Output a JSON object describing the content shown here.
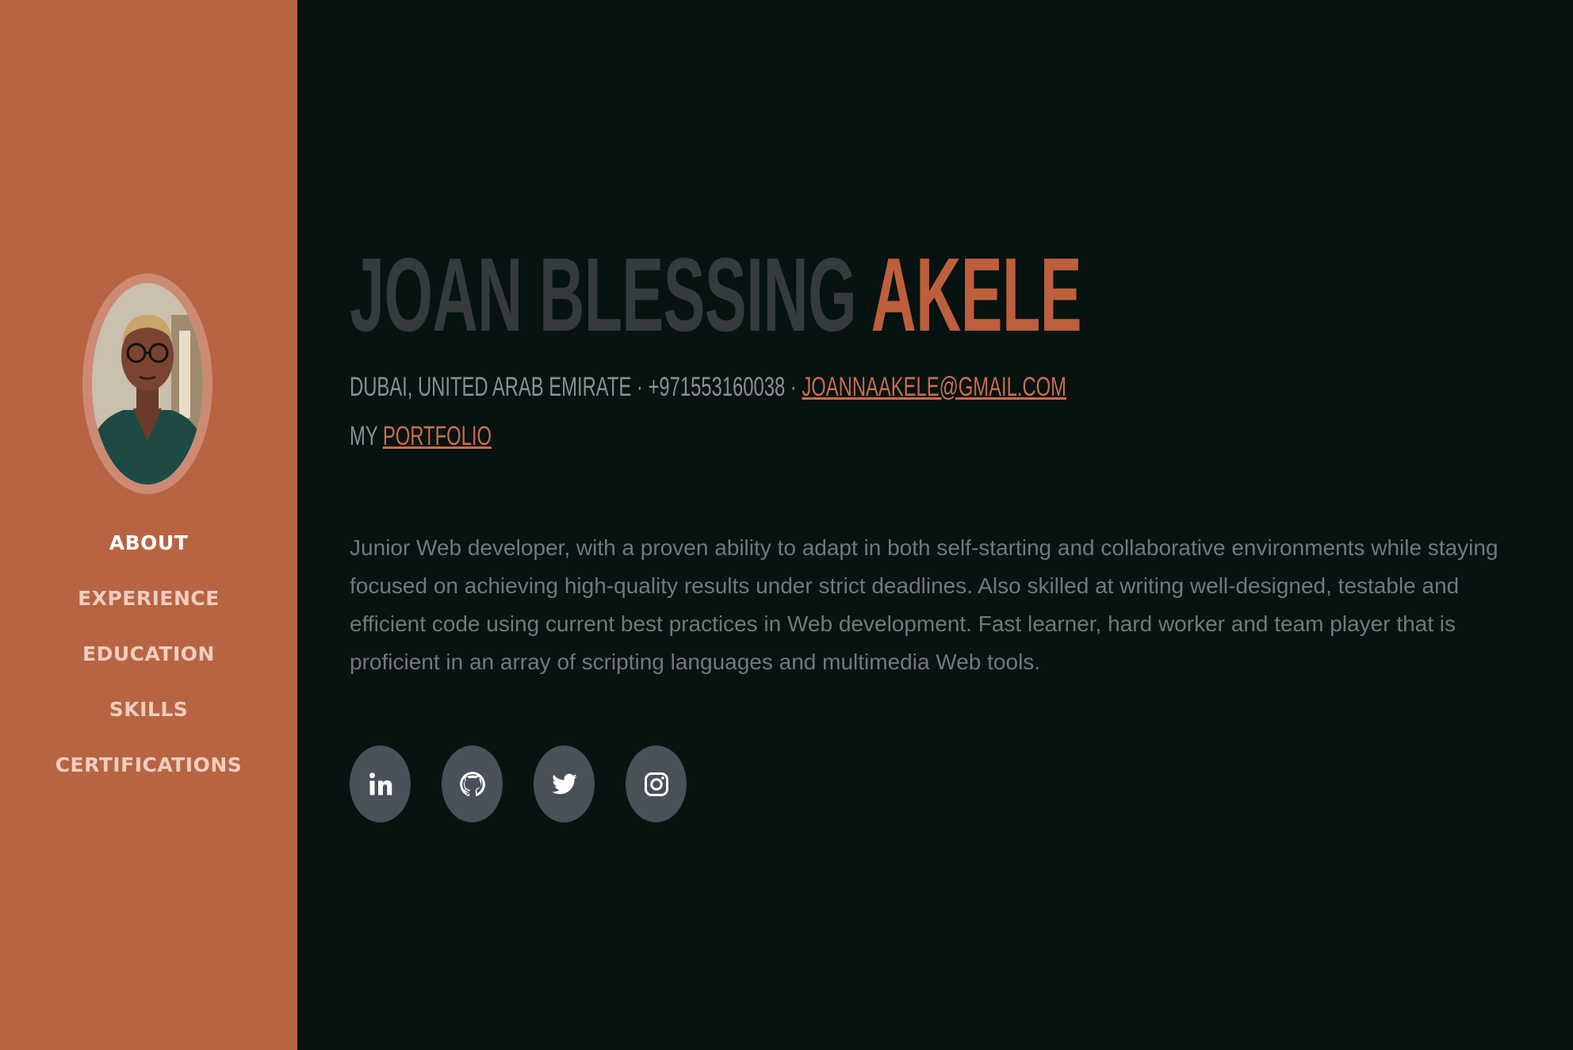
{
  "sidebar": {
    "avatar_alt": "profile photo",
    "nav": [
      {
        "label": "ABOUT",
        "active": true
      },
      {
        "label": "EXPERIENCE",
        "active": false
      },
      {
        "label": "EDUCATION",
        "active": false
      },
      {
        "label": "SKILLS",
        "active": false
      },
      {
        "label": "CERTIFICATIONS",
        "active": false
      }
    ]
  },
  "header": {
    "first_names": "JOAN BLESSING",
    "last_name": "AKELE",
    "location": "DUBAI, UNITED ARAB EMIRATE",
    "separator": "·",
    "phone": "+971553160038",
    "email": "JOANNAAKELE@GMAIL.COM",
    "portfolio_prefix": "MY",
    "portfolio_link": "PORTFOLIO"
  },
  "about": {
    "bio": "Junior Web developer, with a proven ability to adapt in both self-starting and collaborative environments while staying focused on achieving high-quality results under strict deadlines. Also skilled at writing well-designed, testable and efficient code using current best practices in Web development. Fast learner, hard worker and team player that is proficient in an array of scripting languages and multimedia Web tools."
  },
  "social": [
    {
      "icon": "linkedin-icon"
    },
    {
      "icon": "github-icon"
    },
    {
      "icon": "twitter-icon"
    },
    {
      "icon": "instagram-icon"
    }
  ],
  "colors": {
    "sidebar": "#b76443",
    "background": "#061310",
    "accent": "#bd5f3d",
    "name_dark": "#353a3e",
    "social_bg": "#4a5057"
  }
}
